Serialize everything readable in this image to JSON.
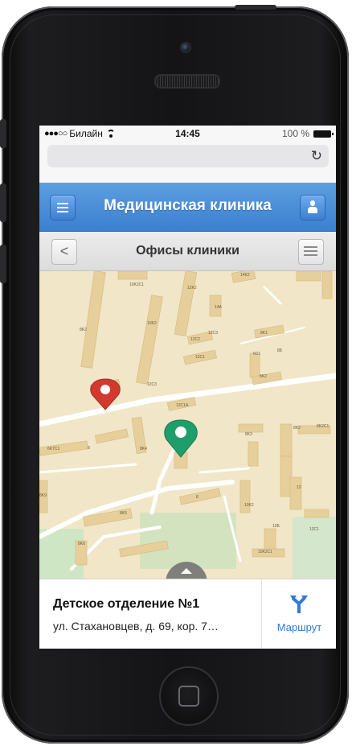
{
  "statusbar": {
    "signal": "●●●○○",
    "carrier": "Билайн",
    "time": "14:45",
    "battery": "100 %",
    "icons": [
      "wifi-icon",
      "battery-icon"
    ]
  },
  "browser": {
    "url": "",
    "reload_icon": "reload-icon"
  },
  "app": {
    "title": "Медицинская клиника",
    "menu_icon": "menu-icon",
    "user_icon": "user-icon",
    "accent_color": "#3b7fd0"
  },
  "subheader": {
    "back_icon": "<",
    "title": "Офисы клиники",
    "list_icon": "list-icon"
  },
  "map": {
    "labels": [
      "10K2C1",
      "12K2",
      "14K2",
      "14A",
      "8K2",
      "10K2",
      "12C2",
      "12C3",
      "12C1",
      "8K1",
      "6C1",
      "8Б",
      "8K3",
      "12C3",
      "12C1A",
      "8K2",
      "6K7C1",
      "8",
      "8K4",
      "8K3",
      "8K2",
      "8K2C1",
      "8K9",
      "8",
      "12",
      "10K2",
      "8K5",
      "12Б",
      "12C1",
      "8K6",
      "10K2C1"
    ],
    "markers": [
      {
        "name": "red-marker",
        "color": "#d23a2f"
      },
      {
        "name": "green-marker",
        "color": "#1e9e6a"
      }
    ]
  },
  "office": {
    "name": "Детское отделение №1",
    "address": "ул. Стахановцев, д. 69, кор. 7…"
  },
  "route": {
    "label": "Маршрут",
    "icon": "route-icon"
  }
}
